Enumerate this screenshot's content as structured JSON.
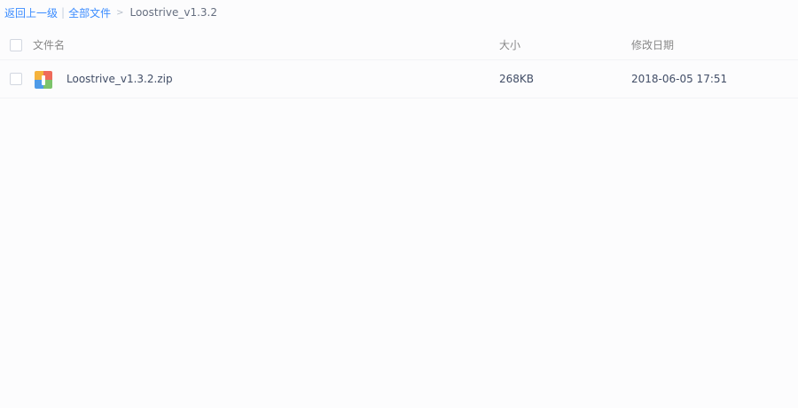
{
  "breadcrumb": {
    "back_label": "返回上一级",
    "separator": "|",
    "all_files_label": "全部文件",
    "arrow": ">",
    "current_folder": "Loostrive_v1.3.2"
  },
  "table": {
    "columns": {
      "name": "文件名",
      "size": "大小",
      "modified": "修改日期"
    },
    "rows": [
      {
        "name": "Loostrive_v1.3.2.zip",
        "size": "268KB",
        "modified": "2018-06-05 17:51",
        "icon": "zip-archive-icon"
      }
    ]
  },
  "colors": {
    "link": "#3b8cff",
    "text": "#424e67",
    "header_text": "#888888"
  }
}
